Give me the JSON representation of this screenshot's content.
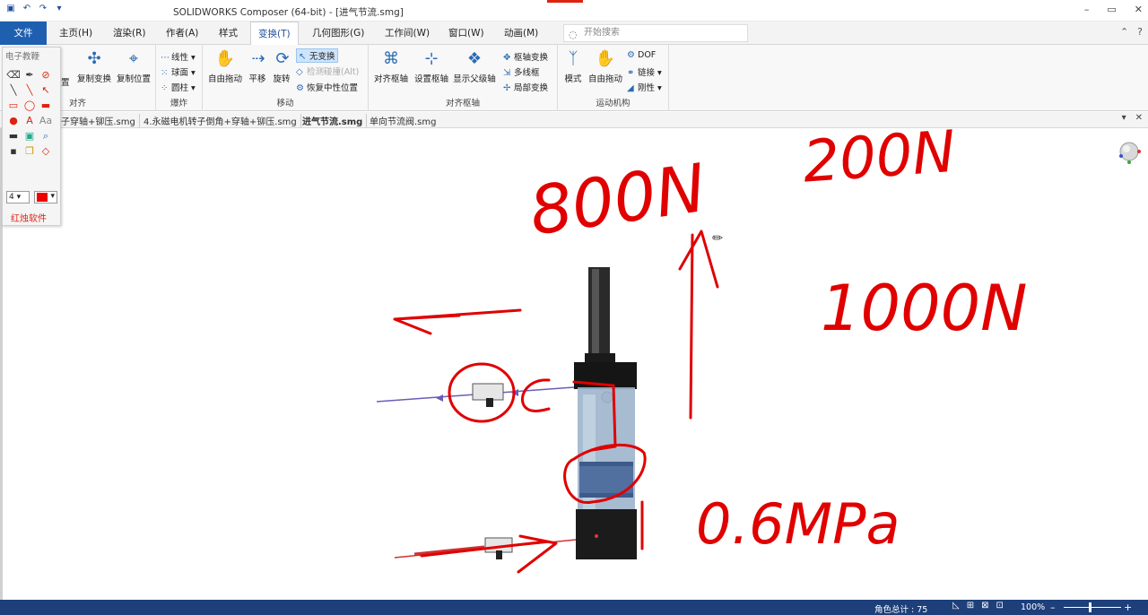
{
  "window": {
    "title": "SOLIDWORKS Composer (64-bit) - [进气节流.smg]"
  },
  "menu": {
    "file": "文件",
    "tabs": [
      "主页(H)",
      "渲染(R)",
      "作者(A)",
      "样式",
      "变换(T)",
      "几何图形(G)",
      "工作间(W)",
      "窗口(W)",
      "动画(M)"
    ],
    "active_tab": "变换(T)",
    "search_placeholder": "开始搜索"
  },
  "ribbon": {
    "groups": {
      "align": {
        "label": "对齐",
        "btn_partial": "置",
        "copy_transform": "复制变换",
        "copy_position": "复制位置"
      },
      "explode": {
        "label": "爆炸",
        "linear": "线性",
        "sphere": "球面",
        "cylinder": "圆柱"
      },
      "move": {
        "label": "移动",
        "free_drag": "自由拖动",
        "translate": "平移",
        "rotate": "旋转",
        "no_transform": "无变换",
        "detect_collision": "检测碰撞(Alt)",
        "restore_neutral": "恢复中性位置"
      },
      "pivot": {
        "label": "对齐枢轴",
        "align_pivot": "对齐枢轴",
        "set_pivot": "设置枢轴",
        "show_parent_pivot": "显示父级轴",
        "pivot_transform": "枢轴变换",
        "multi_wireframe": "多线框",
        "local_transform": "局部变换"
      },
      "kinematics": {
        "label": "运动机构",
        "mode": "模式",
        "free_drag": "自由拖动",
        "dof": "DOF",
        "link": "链接",
        "rigid": "刚性"
      }
    }
  },
  "documents": {
    "tabs": [
      "子穿轴+铆压.smg",
      "4.永磁电机转子倒角+穿轴+铆压.smg",
      "进气节流.smg",
      "单向节流阀.smg"
    ],
    "active": "进气节流.smg"
  },
  "drawing_tool": {
    "title": "电子教鞭",
    "size": "4",
    "color": "#e00000",
    "brand": "红烛软件"
  },
  "annotations": {
    "text_800": "800N",
    "text_200": "200N",
    "text_1000": "1000N",
    "text_pressure": "0.6MPa",
    "ink_color": "#e00000"
  },
  "status": {
    "role_count": "角色总计 : 75",
    "zoom": "100%"
  }
}
